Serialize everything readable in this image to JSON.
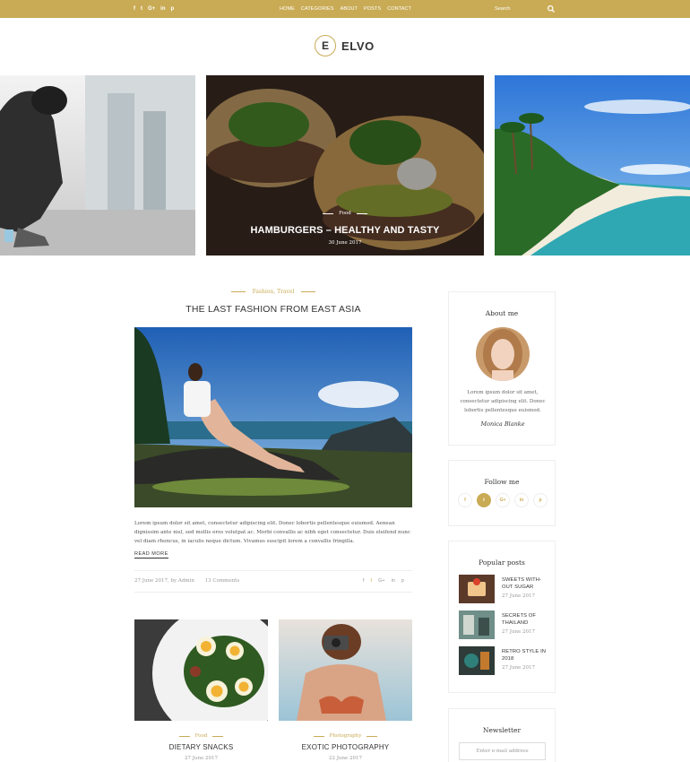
{
  "topbar": {
    "social": [
      "f",
      "t",
      "G+",
      "in",
      "p"
    ],
    "nav": [
      "HOME",
      "CATEGORIES",
      "ABOUT",
      "POSTS",
      "CONTACT"
    ],
    "search_placeholder": "Search"
  },
  "logo": {
    "letter": "E",
    "name": "ELVO"
  },
  "slider": {
    "featured": {
      "category": "Food",
      "title": "HAMBURGERS – HEALTHY AND TASTY",
      "date": "30 June 2017"
    }
  },
  "main_post": {
    "category": "Fashion, Travel",
    "title": "THE LAST FASHION FROM EAST ASIA",
    "excerpt": "Lorem ipsum dolor sit amet, consectetur adipiscing elit. Donec lobortis pellentesque euismod. Aenean dignissim ante nisl, sed mollis eros volutpat ac. Morbi convallis ac nibh eget consectetur. Duis eleifend nunc vel diam rhoncus, in iaculis neque dictum. Vivamus suscipit lorem a convallis fringilla.",
    "read_more": "READ MORE",
    "date_author": "27 June 2017, by Admin",
    "comments": "13 Comments",
    "share": [
      "f",
      "t",
      "G+",
      "in",
      "p"
    ]
  },
  "grid_posts": [
    {
      "category": "Food",
      "title": "DIETARY SNACKS",
      "date": "27 June 2017"
    },
    {
      "category": "Photography",
      "title": "EXOTIC PHOTOGRAPHY",
      "date": "22 June 2017"
    }
  ],
  "sidebar": {
    "about": {
      "title": "About me",
      "text": "Lorem ipsum dolor sit amet, consectetur adipiscing elit. Donec lobortis pellentesque euismod.",
      "signature": "Monica Blanke"
    },
    "follow": {
      "title": "Follow me",
      "icons": [
        "f",
        "t",
        "G+",
        "in",
        "p"
      ]
    },
    "popular": {
      "title": "Popular posts",
      "items": [
        {
          "title": "SWEETS WITH-OUT SUGAR",
          "date": "27 June 2017"
        },
        {
          "title": "SECRETS OF THAILAND",
          "date": "27 June 2017"
        },
        {
          "title": "RETRO STYLE IN 2018",
          "date": "27 June 2017"
        }
      ]
    },
    "newsletter": {
      "title": "Newsletter",
      "placeholder": "Enter e-mail address"
    }
  },
  "colors": {
    "accent": "#c9ab55"
  }
}
